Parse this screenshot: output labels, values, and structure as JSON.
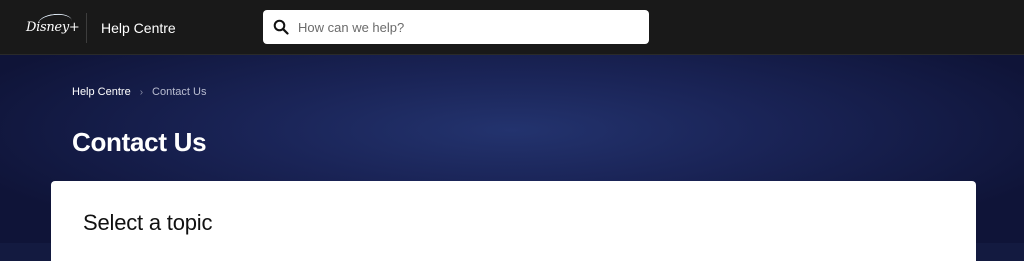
{
  "header": {
    "logo_text": "Disney+",
    "title": "Help Centre",
    "search": {
      "placeholder": "How can we help?",
      "value": "",
      "icon": "search-icon"
    }
  },
  "breadcrumb": {
    "items": [
      {
        "label": "Help Centre",
        "link": true
      },
      {
        "label": "Contact Us",
        "link": false
      }
    ],
    "separator_icon": "chevron-right-icon"
  },
  "page": {
    "title": "Contact Us",
    "card_title": "Select a topic"
  },
  "colors": {
    "topbar": "#191919",
    "hero_center": "#23336e",
    "hero_edge": "#0f1438",
    "card": "#ffffff"
  }
}
